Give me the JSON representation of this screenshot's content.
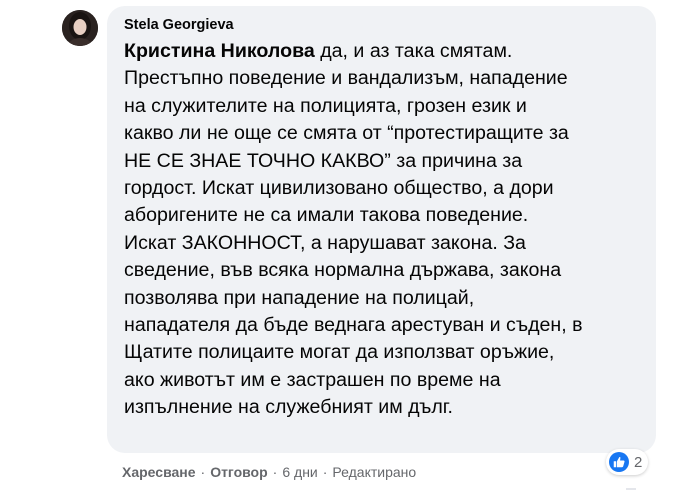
{
  "comment": {
    "author": "Stela Georgieva",
    "mention": "Кристина Николова",
    "text": " да, и аз така смятам.\nПрестъпно поведение и вандализъм, нападение\nна служителите на полицията, грозен език и\nкакво ли не още се смята от “протестиращите за\nНЕ СЕ ЗНАЕ ТОЧНО КАКВО” за причина за\nгордост. Искат цивилизовано общество, а дори\nаборигените не са имали такова поведение.\nИскат ЗАКОННОСТ, а нарушават закона. За\nсведение, във всяка нормална държава, закона\nпозволява при нападение на полицай,\nнападателя да бъде веднага арестуван и съден, в\nЩатите полицаите могат да използват оръжие,\nако животът им е застрашен по време на\nизпълнение на служебният им дълг."
  },
  "actions": {
    "like_label": "Харесване",
    "reply_label": "Отговор",
    "separator": "·",
    "time": "6 дни",
    "edited": "Редактирано"
  },
  "reactions": {
    "icon": "like-icon",
    "count": "2",
    "color": "#1877f2"
  }
}
